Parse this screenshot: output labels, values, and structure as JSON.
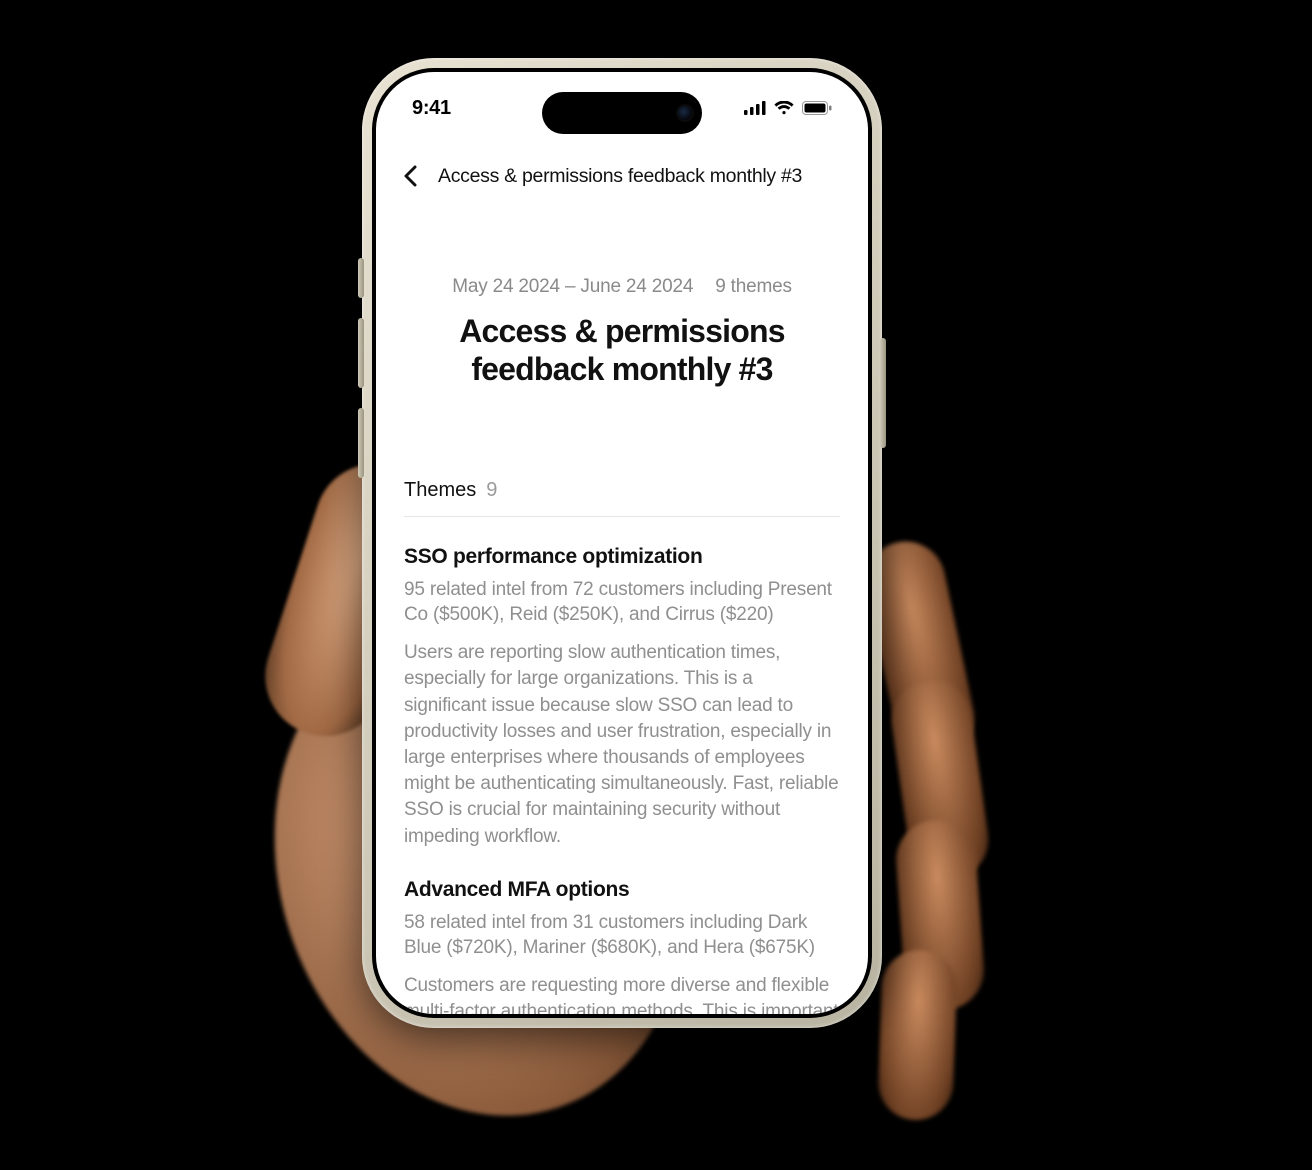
{
  "status": {
    "time": "9:41"
  },
  "nav": {
    "title": "Access & permissions feedback monthly #3"
  },
  "meta": {
    "date_range": "May 24 2024 – June 24 2024",
    "themes_summary": "9 themes"
  },
  "page": {
    "title": "Access & permissions feedback monthly #3"
  },
  "section": {
    "label": "Themes",
    "count": "9"
  },
  "themes": [
    {
      "title": "SSO performance optimization",
      "sub": "95 related intel from 72 customers including Present Co ($500K), Reid ($250K), and Cirrus ($220)",
      "body": "Users are reporting slow authentication times, especially for large organizations. This is a significant issue because slow SSO can lead to productivity losses and user frustration, especially in large enterprises where thousands of employees might be authenticating simultaneously. Fast, reliable SSO is crucial for maintaining security without impeding workflow."
    },
    {
      "title": "Advanced MFA options",
      "sub": "58 related intel from 31 customers including Dark Blue ($720K), Mariner ($680K), and Hera ($675K)",
      "body": "Customers are requesting more diverse and flexible multi-factor authentication methods. This is important"
    }
  ]
}
